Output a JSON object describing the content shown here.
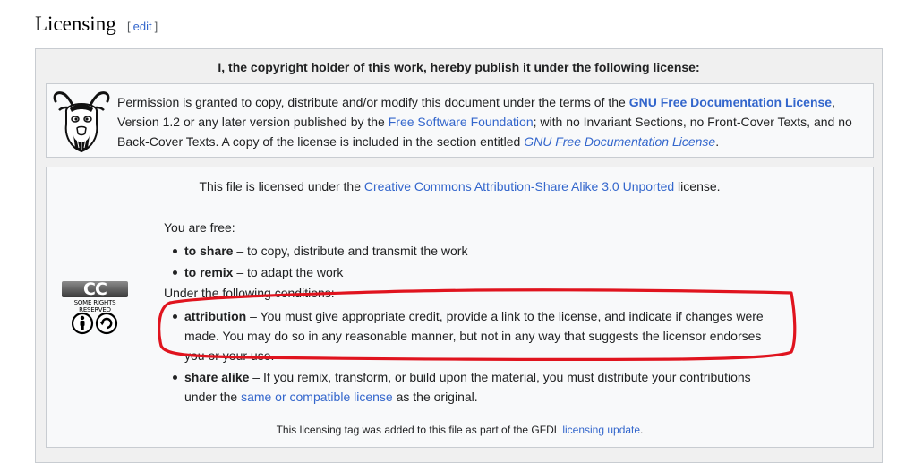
{
  "heading": {
    "title": "Licensing",
    "bracket_open": "[",
    "edit_label": "edit",
    "bracket_close": "]"
  },
  "header_statement": "I, the copyright holder of this work, hereby publish it under the following license:",
  "gfdl": {
    "logo_icon": "gnu-head-icon",
    "t1": "Permission is granted to copy, distribute and/or modify this document under the terms of the ",
    "link_gfdl": "GNU Free Documentation License",
    "t2": ", Version 1.2 or any later version published by the ",
    "link_fsf": "Free Software Foundation",
    "t3": "; with no Invariant Sections, no Front-Cover Texts, and no Back-Cover Texts. A copy of the license is included in the section entitled ",
    "link_gfdl_section": "GNU Free Documentation License",
    "t4": "."
  },
  "cc": {
    "intro_prefix": "This file is licensed under the ",
    "intro_link": "Creative Commons Attribution-Share Alike 3.0 Unported",
    "intro_suffix": " license.",
    "logo": {
      "letters": "CC",
      "rights": "SOME RIGHTS RESERVED",
      "icons": [
        "attribution-icon",
        "share-alike-icon"
      ]
    },
    "free_label": "You are free:",
    "freedoms": [
      {
        "term": "to share",
        "desc": " – to copy, distribute and transmit the work"
      },
      {
        "term": "to remix",
        "desc": " – to adapt the work"
      }
    ],
    "conditions_label": "Under the following conditions:",
    "conditions": [
      {
        "term": "attribution",
        "desc": " – You must give appropriate credit, provide a link to the license, and indicate if changes were made. You may do so in any reasonable manner, but not in any way that suggests the licensor endorses you or your use."
      },
      {
        "term": "share alike",
        "desc": " – If you remix, transform, or build upon the material, you must distribute your contributions under the ",
        "link": "same or compatible license",
        "suffix": " as the original."
      }
    ]
  },
  "footer": {
    "prefix": "This licensing tag was added to this file as part of the GFDL ",
    "link": "licensing update",
    "suffix": "."
  },
  "colors": {
    "link": "#3366cc",
    "annotation": "#e0141e",
    "box_bg": "#f8f9fa",
    "outer_bg": "#f0f0f0"
  }
}
